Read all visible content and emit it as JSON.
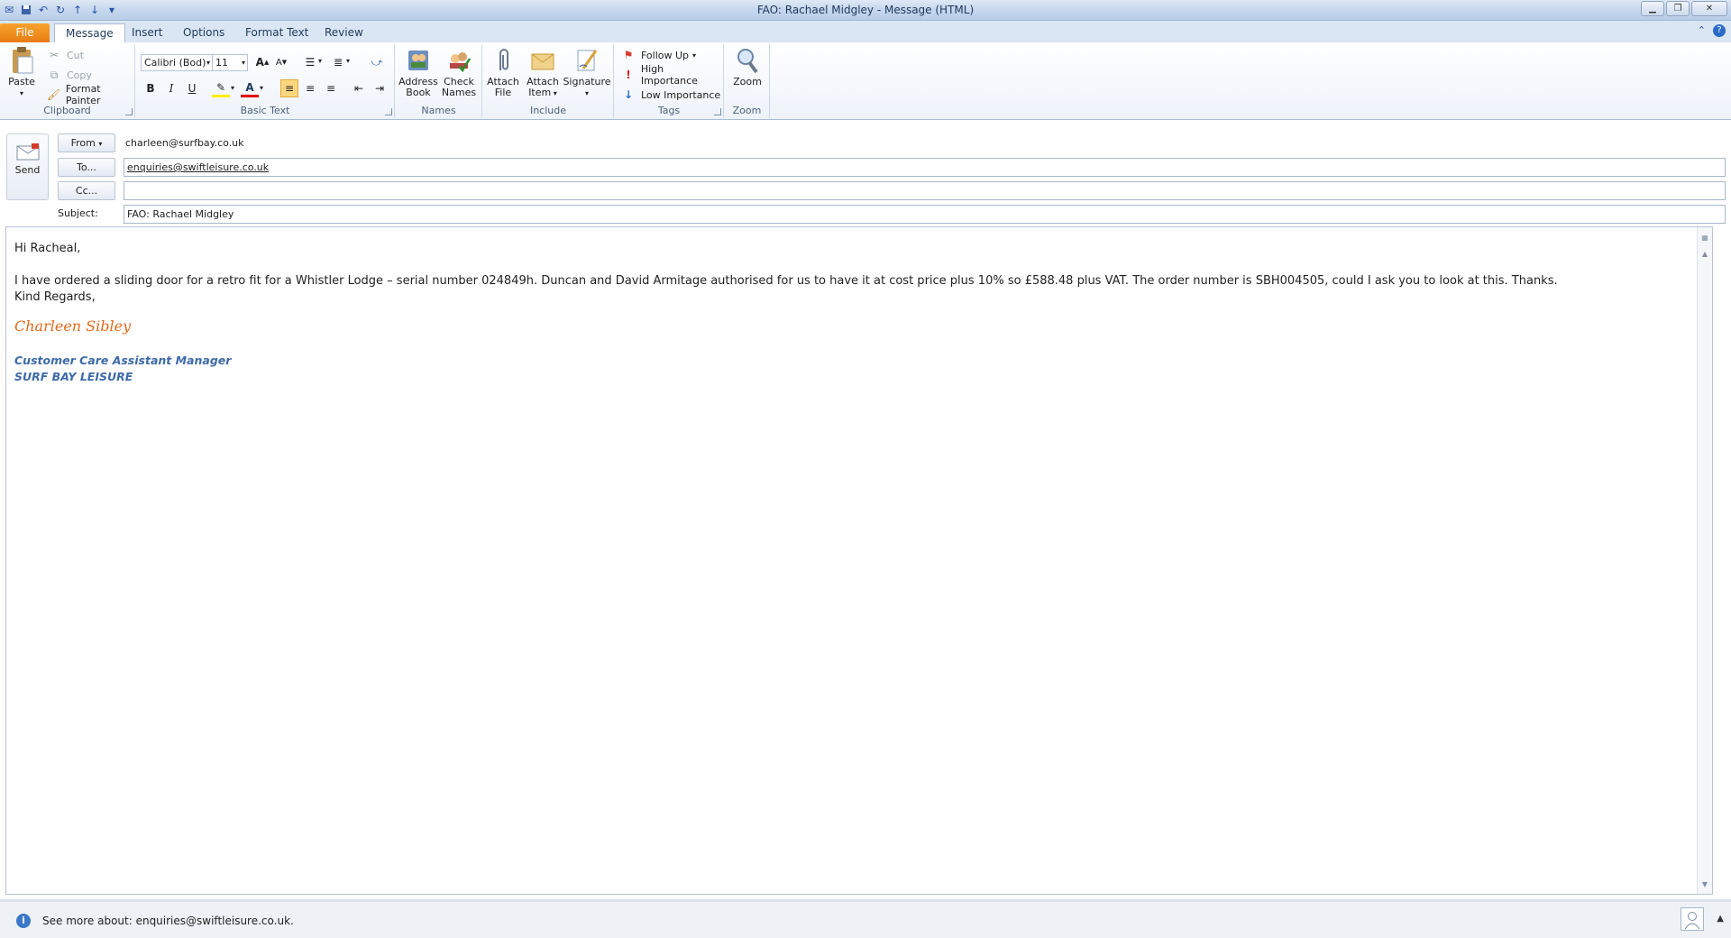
{
  "window": {
    "title": "FAO: Rachael Midgley  -  Message (HTML)"
  },
  "tabs": [
    {
      "label": "File"
    },
    {
      "label": "Message"
    },
    {
      "label": "Insert"
    },
    {
      "label": "Options"
    },
    {
      "label": "Format Text"
    },
    {
      "label": "Review"
    }
  ],
  "ribbon": {
    "clipboard": {
      "label": "Clipboard",
      "paste": "Paste",
      "cut": "Cut",
      "copy": "Copy",
      "format_painter": "Format Painter"
    },
    "basic_text": {
      "label": "Basic Text",
      "font": "Calibri (Bod)",
      "size": "11"
    },
    "names": {
      "label": "Names",
      "address_book_1": "Address",
      "address_book_2": "Book",
      "check_names_1": "Check",
      "check_names_2": "Names"
    },
    "include": {
      "label": "Include",
      "attach_file_1": "Attach",
      "attach_file_2": "File",
      "attach_item_1": "Attach",
      "attach_item_2": "Item",
      "signature": "Signature"
    },
    "tags": {
      "label": "Tags",
      "follow_up": "Follow Up",
      "high_importance": "High Importance",
      "low_importance": "Low Importance"
    },
    "zoom": {
      "label": "Zoom",
      "zoom": "Zoom"
    }
  },
  "header": {
    "send": "Send",
    "from_label": "From",
    "from_value": "charleen@surfbay.co.uk",
    "to_label": "To...",
    "to_value": "enquiries@swiftleisure.co.uk",
    "cc_label": "Cc...",
    "cc_value": "",
    "subject_label": "Subject:",
    "subject_value": "FAO: Rachael Midgley"
  },
  "body": {
    "greeting": "Hi Racheal,",
    "paragraph": "I have ordered a sliding door for a retro fit for a Whistler Lodge – serial number 024849h.  Duncan and David Armitage authorised for us to have it at cost price plus 10% so £588.48 plus VAT.  The order number is SBH004505, could I ask you to look at this. Thanks.",
    "closing": "Kind Regards,",
    "signature_name": "Charleen Sibley",
    "signature_title": "Customer Care Assistant Manager",
    "signature_company": "SURF BAY LEISURE"
  },
  "footer": {
    "people_info": "See more about: enquiries@swiftleisure.co.uk."
  },
  "colors": {
    "accent": "#e87c10",
    "signature_name": "#e16a1a",
    "signature_title": "#3e6aa8"
  }
}
